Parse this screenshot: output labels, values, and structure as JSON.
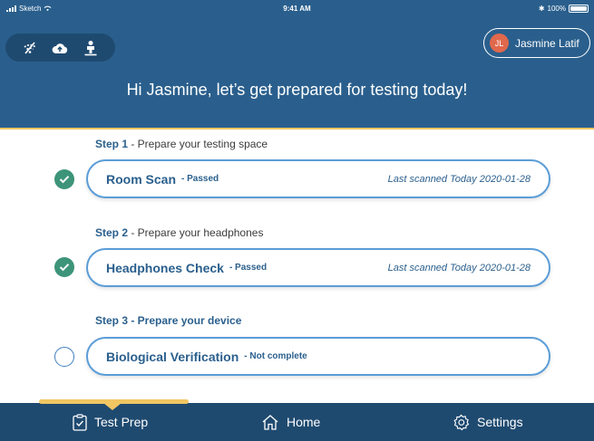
{
  "statusbar": {
    "carrier": "Sketch",
    "time": "9:41 AM",
    "battery": "100%"
  },
  "toolbar": {
    "icons": [
      "no-wifi-icon",
      "cloud-upload-icon",
      "person-location-icon"
    ]
  },
  "user": {
    "initials": "JL",
    "name": "Jasmine Latif"
  },
  "greeting": "Hi Jasmine, let’s get prepared for testing today!",
  "steps": [
    {
      "step_num": "Step 1",
      "step_desc": " - Prepare your testing space",
      "title": "Room Scan",
      "status": " - Passed",
      "meta": "Last scanned Today 2020-01-28",
      "done": true
    },
    {
      "step_num": "Step 2",
      "step_desc": " - Prepare your headphones",
      "title": "Headphones Check",
      "status": " - Passed",
      "meta": "Last scanned Today 2020-01-28",
      "done": true
    },
    {
      "step_num": "Step 3",
      "step_desc": " - Prepare your device",
      "title": "Biological Verification",
      "status": " - Not complete",
      "meta": "",
      "done": false
    }
  ],
  "tabs": [
    {
      "label": "Test Prep",
      "icon": "clipboard-check-icon",
      "active": true
    },
    {
      "label": "Home",
      "icon": "home-icon",
      "active": false
    },
    {
      "label": "Settings",
      "icon": "gear-icon",
      "active": false
    }
  ],
  "colors": {
    "header": "#2a5f8d",
    "accent": "#f1c663",
    "success": "#3d9479",
    "avatar": "#e0684c"
  }
}
